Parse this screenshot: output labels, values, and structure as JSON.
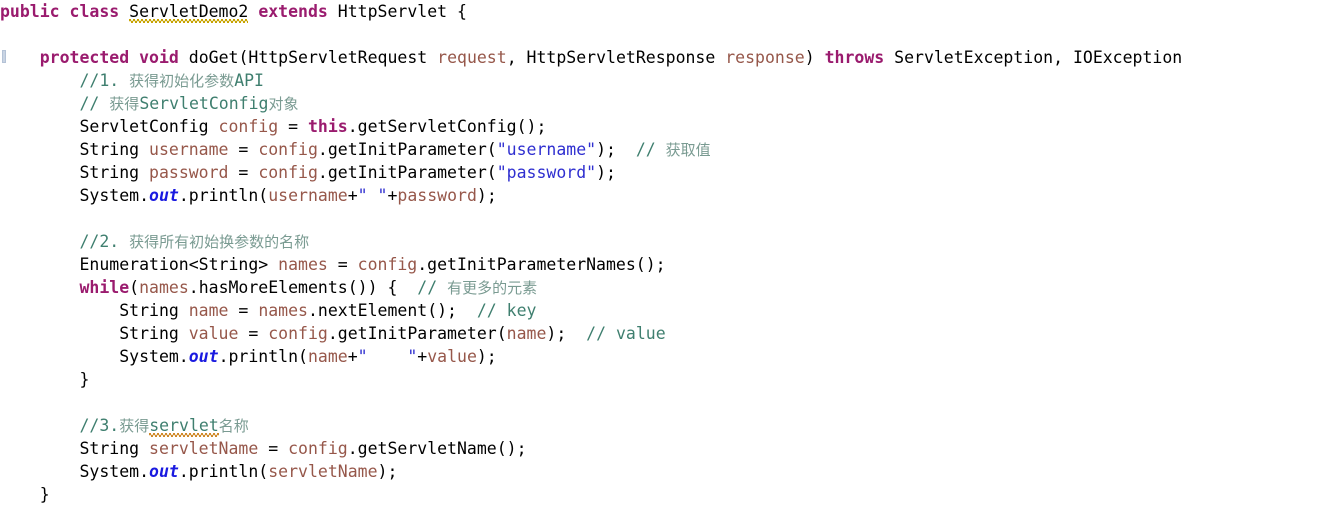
{
  "editor": {
    "language": "java",
    "background_color": "#ffffff",
    "gutter_marker_color": "#c9d4e3",
    "colors": {
      "keyword": "#9a1b6e",
      "plain": "#000000",
      "parameter": "#96574a",
      "string": "#2f2fd0",
      "comment": "#3f7f6f",
      "comment_cjk": "#7a9b92",
      "static_field": "#1a1ae0",
      "spellcheck_squiggle": "#c8a400",
      "spellcheck_squiggle_orange": "#d08a2a"
    }
  },
  "code": {
    "lines": [
      {
        "id": "line-class-decl",
        "tokens": [
          {
            "t": "public",
            "c": "kw"
          },
          {
            "t": " ",
            "c": "plain"
          },
          {
            "t": "class",
            "c": "kw"
          },
          {
            "t": " ",
            "c": "plain"
          },
          {
            "t": "ServletDemo2",
            "c": "plain",
            "squiggle": true
          },
          {
            "t": " ",
            "c": "plain"
          },
          {
            "t": "extends",
            "c": "kw"
          },
          {
            "t": " ",
            "c": "plain"
          },
          {
            "t": "HttpServlet",
            "c": "plain"
          },
          {
            "t": " {",
            "c": "plain"
          }
        ]
      },
      {
        "id": "line-blank-1",
        "tokens": []
      },
      {
        "id": "line-doget-signature",
        "tokens": [
          {
            "t": "    ",
            "c": "plain"
          },
          {
            "t": "protected",
            "c": "kw"
          },
          {
            "t": " ",
            "c": "plain"
          },
          {
            "t": "void",
            "c": "kw"
          },
          {
            "t": " ",
            "c": "plain"
          },
          {
            "t": "doGet(HttpServletRequest ",
            "c": "plain"
          },
          {
            "t": "request",
            "c": "param"
          },
          {
            "t": ", HttpServletResponse ",
            "c": "plain"
          },
          {
            "t": "response",
            "c": "param"
          },
          {
            "t": ")",
            "c": "plain"
          },
          {
            "t": " ",
            "c": "plain"
          },
          {
            "t": "throws",
            "c": "kw"
          },
          {
            "t": " ServletException, IOException",
            "c": "plain"
          }
        ]
      },
      {
        "id": "line-comment-1",
        "tokens": [
          {
            "t": "        ",
            "c": "plain"
          },
          {
            "t": "//1.",
            "c": "cmt"
          },
          {
            "t": " ",
            "c": "plain"
          },
          {
            "t": "获得初始化参数",
            "c": "cmtcn"
          },
          {
            "t": "API",
            "c": "cmtcn-mono"
          }
        ]
      },
      {
        "id": "line-comment-2",
        "tokens": [
          {
            "t": "        ",
            "c": "plain"
          },
          {
            "t": "//",
            "c": "cmt"
          },
          {
            "t": " ",
            "c": "plain"
          },
          {
            "t": "获得",
            "c": "cmtcn"
          },
          {
            "t": "ServletConfig",
            "c": "cmtcn-mono"
          },
          {
            "t": "对象",
            "c": "cmtcn"
          }
        ]
      },
      {
        "id": "line-servletconfig",
        "tokens": [
          {
            "t": "        ServletConfig ",
            "c": "plain"
          },
          {
            "t": "config",
            "c": "param"
          },
          {
            "t": " = ",
            "c": "plain"
          },
          {
            "t": "this",
            "c": "kw"
          },
          {
            "t": ".getServletConfig();",
            "c": "plain"
          }
        ]
      },
      {
        "id": "line-username",
        "tokens": [
          {
            "t": "        String ",
            "c": "plain"
          },
          {
            "t": "username",
            "c": "param"
          },
          {
            "t": " = ",
            "c": "plain"
          },
          {
            "t": "config",
            "c": "param"
          },
          {
            "t": ".getInitParameter(",
            "c": "plain"
          },
          {
            "t": "\"username\"",
            "c": "str"
          },
          {
            "t": ");",
            "c": "plain"
          },
          {
            "t": "  ",
            "c": "plain"
          },
          {
            "t": "//",
            "c": "cmt"
          },
          {
            "t": " ",
            "c": "plain"
          },
          {
            "t": "获取值",
            "c": "cmtcn"
          }
        ]
      },
      {
        "id": "line-password",
        "tokens": [
          {
            "t": "        String ",
            "c": "plain"
          },
          {
            "t": "password",
            "c": "param"
          },
          {
            "t": " = ",
            "c": "plain"
          },
          {
            "t": "config",
            "c": "param"
          },
          {
            "t": ".getInitParameter(",
            "c": "plain"
          },
          {
            "t": "\"password\"",
            "c": "str"
          },
          {
            "t": ");",
            "c": "plain"
          }
        ]
      },
      {
        "id": "line-print-userpass",
        "tokens": [
          {
            "t": "        System.",
            "c": "plain"
          },
          {
            "t": "out",
            "c": "field"
          },
          {
            "t": ".println(",
            "c": "plain"
          },
          {
            "t": "username",
            "c": "param"
          },
          {
            "t": "+",
            "c": "plain"
          },
          {
            "t": "\" \"",
            "c": "str"
          },
          {
            "t": "+",
            "c": "plain"
          },
          {
            "t": "password",
            "c": "param"
          },
          {
            "t": ");",
            "c": "plain"
          }
        ]
      },
      {
        "id": "line-blank-2",
        "tokens": []
      },
      {
        "id": "line-comment-3",
        "tokens": [
          {
            "t": "        ",
            "c": "plain"
          },
          {
            "t": "//2.",
            "c": "cmt"
          },
          {
            "t": " ",
            "c": "plain"
          },
          {
            "t": "获得所有初始换参数的名称",
            "c": "cmtcn"
          }
        ]
      },
      {
        "id": "line-enumeration",
        "tokens": [
          {
            "t": "        Enumeration<String> ",
            "c": "plain"
          },
          {
            "t": "names",
            "c": "param"
          },
          {
            "t": " = ",
            "c": "plain"
          },
          {
            "t": "config",
            "c": "param"
          },
          {
            "t": ".getInitParameterNames();",
            "c": "plain"
          }
        ]
      },
      {
        "id": "line-while",
        "tokens": [
          {
            "t": "        ",
            "c": "plain"
          },
          {
            "t": "while",
            "c": "kw"
          },
          {
            "t": "(",
            "c": "plain"
          },
          {
            "t": "names",
            "c": "param"
          },
          {
            "t": ".hasMoreElements()) {",
            "c": "plain"
          },
          {
            "t": "  ",
            "c": "plain"
          },
          {
            "t": "//",
            "c": "cmt"
          },
          {
            "t": " ",
            "c": "plain"
          },
          {
            "t": "有更多的元素",
            "c": "cmtcn"
          }
        ]
      },
      {
        "id": "line-name",
        "tokens": [
          {
            "t": "            String ",
            "c": "plain"
          },
          {
            "t": "name",
            "c": "param"
          },
          {
            "t": " = ",
            "c": "plain"
          },
          {
            "t": "names",
            "c": "param"
          },
          {
            "t": ".nextElement();",
            "c": "plain"
          },
          {
            "t": "  ",
            "c": "plain"
          },
          {
            "t": "// key",
            "c": "cmt"
          }
        ]
      },
      {
        "id": "line-value",
        "tokens": [
          {
            "t": "            String ",
            "c": "plain"
          },
          {
            "t": "value",
            "c": "param"
          },
          {
            "t": " = ",
            "c": "plain"
          },
          {
            "t": "config",
            "c": "param"
          },
          {
            "t": ".getInitParameter(",
            "c": "plain"
          },
          {
            "t": "name",
            "c": "param"
          },
          {
            "t": ");",
            "c": "plain"
          },
          {
            "t": "  ",
            "c": "plain"
          },
          {
            "t": "// value",
            "c": "cmt"
          }
        ]
      },
      {
        "id": "line-print-namevalue",
        "tokens": [
          {
            "t": "            System.",
            "c": "plain"
          },
          {
            "t": "out",
            "c": "field"
          },
          {
            "t": ".println(",
            "c": "plain"
          },
          {
            "t": "name",
            "c": "param"
          },
          {
            "t": "+",
            "c": "plain"
          },
          {
            "t": "\"    \"",
            "c": "str"
          },
          {
            "t": "+",
            "c": "plain"
          },
          {
            "t": "value",
            "c": "param"
          },
          {
            "t": ");",
            "c": "plain"
          }
        ]
      },
      {
        "id": "line-close-while",
        "tokens": [
          {
            "t": "        }",
            "c": "plain"
          }
        ]
      },
      {
        "id": "line-blank-3",
        "tokens": []
      },
      {
        "id": "line-comment-4",
        "tokens": [
          {
            "t": "        ",
            "c": "plain"
          },
          {
            "t": "//3.",
            "c": "cmt"
          },
          {
            "t": "获得",
            "c": "cmtcn"
          },
          {
            "t": "servlet",
            "c": "cmtcn-mono",
            "squiggle_orange": true
          },
          {
            "t": "名称",
            "c": "cmtcn"
          }
        ]
      },
      {
        "id": "line-servletname",
        "tokens": [
          {
            "t": "        String ",
            "c": "plain"
          },
          {
            "t": "servletName",
            "c": "param"
          },
          {
            "t": " = ",
            "c": "plain"
          },
          {
            "t": "config",
            "c": "param"
          },
          {
            "t": ".getServletName();",
            "c": "plain"
          }
        ]
      },
      {
        "id": "line-print-servletname",
        "tokens": [
          {
            "t": "        System.",
            "c": "plain"
          },
          {
            "t": "out",
            "c": "field"
          },
          {
            "t": ".println(",
            "c": "plain"
          },
          {
            "t": "servletName",
            "c": "param"
          },
          {
            "t": ");",
            "c": "plain"
          }
        ]
      },
      {
        "id": "line-close-method",
        "tokens": [
          {
            "t": "    }",
            "c": "plain"
          }
        ]
      }
    ]
  }
}
